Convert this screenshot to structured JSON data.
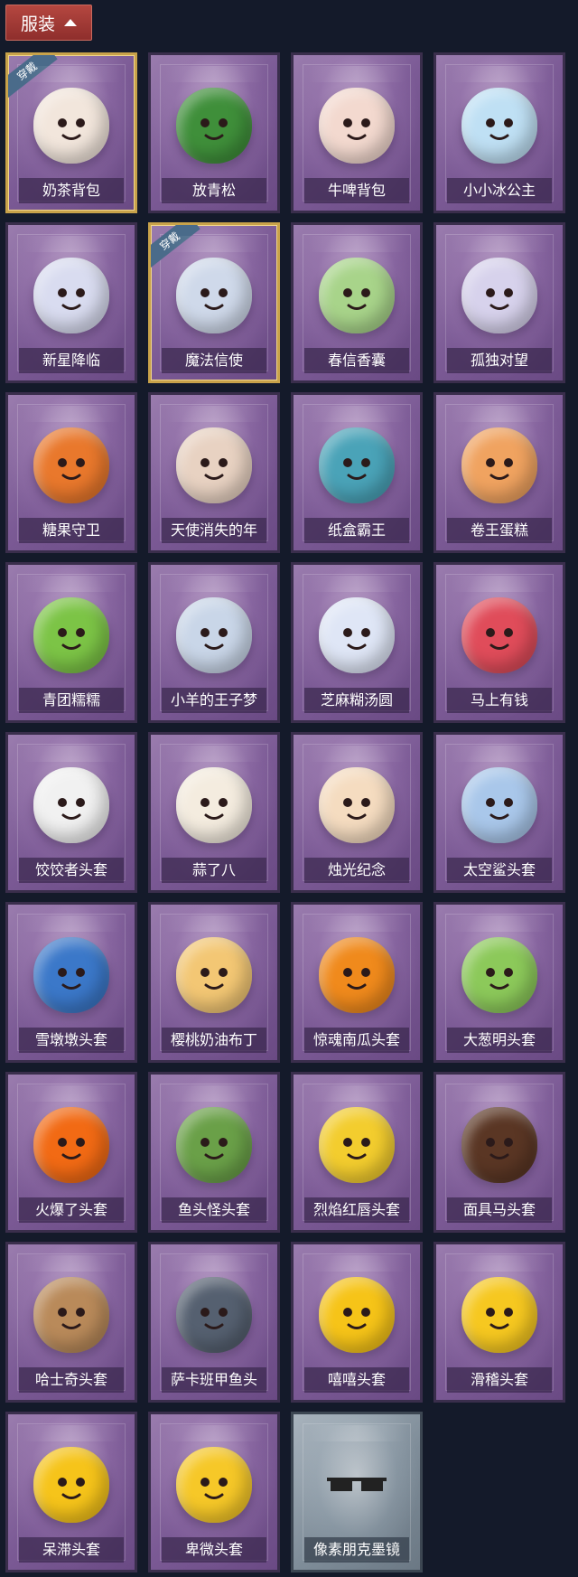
{
  "header": {
    "title": "服装",
    "toggle_icon": "chevron-up-icon"
  },
  "items": [
    {
      "name": "奶茶背包",
      "worn": true,
      "badge": "穿戴",
      "color": "#f2e6dc",
      "icon": "milk-tea-backpack-icon"
    },
    {
      "name": "放青松",
      "worn": false,
      "color": "#3f8f3a",
      "icon": "bonsai-pine-icon"
    },
    {
      "name": "牛啤背包",
      "worn": false,
      "color": "#f3d9cf",
      "icon": "cow-beer-mug-icon"
    },
    {
      "name": "小小冰公主",
      "worn": false,
      "color": "#bfe0f4",
      "icon": "ice-princess-icon"
    },
    {
      "name": "新星降临",
      "worn": false,
      "color": "#d9dcf0",
      "icon": "star-doll-icon"
    },
    {
      "name": "魔法信使",
      "worn": true,
      "badge": "穿戴",
      "color": "#cfd9ea",
      "icon": "elephant-icon"
    },
    {
      "name": "春信香囊",
      "worn": false,
      "color": "#a8d48a",
      "icon": "sachet-icon"
    },
    {
      "name": "孤独对望",
      "worn": false,
      "color": "#d7d2ec",
      "icon": "lonely-doll-icon"
    },
    {
      "name": "糖果守卫",
      "worn": false,
      "color": "#e9782c",
      "icon": "pumpkin-scarecrow-icon"
    },
    {
      "name": "天使消失的年",
      "worn": false,
      "color": "#e8d2c2",
      "icon": "angel-doll-icon"
    },
    {
      "name": "纸盒霸王",
      "worn": false,
      "color": "#4aa3b8",
      "icon": "box-dino-icon"
    },
    {
      "name": "卷王蛋糕",
      "worn": false,
      "color": "#f0a360",
      "icon": "roll-cake-icon"
    },
    {
      "name": "青团糯糯",
      "worn": false,
      "color": "#7cc446",
      "icon": "green-dumpling-icon"
    },
    {
      "name": "小羊的王子梦",
      "worn": false,
      "color": "#c9d6e8",
      "icon": "sheep-prince-icon"
    },
    {
      "name": "芝麻糊汤圆",
      "worn": false,
      "color": "#dfe6f6",
      "icon": "rice-ball-icon"
    },
    {
      "name": "马上有钱",
      "worn": false,
      "color": "#e04c5a",
      "icon": "red-horse-icon"
    },
    {
      "name": "饺饺者头套",
      "worn": false,
      "color": "#f1f1f1",
      "icon": "dumpling-head-icon"
    },
    {
      "name": "蒜了八",
      "worn": false,
      "color": "#f4ecdf",
      "icon": "garlic-icon"
    },
    {
      "name": "烛光纪念",
      "worn": false,
      "color": "#f5dcc0",
      "icon": "candle-icon"
    },
    {
      "name": "太空鲨头套",
      "worn": false,
      "color": "#a9c7ea",
      "icon": "shark-head-icon"
    },
    {
      "name": "雪墩墩头套",
      "worn": false,
      "color": "#3b78c9",
      "icon": "snow-hat-icon"
    },
    {
      "name": "樱桃奶油布丁",
      "worn": false,
      "color": "#f3c774",
      "icon": "pudding-icon"
    },
    {
      "name": "惊魂南瓜头套",
      "worn": false,
      "color": "#f08a1c",
      "icon": "pumpkin-head-icon"
    },
    {
      "name": "大葱明头套",
      "worn": false,
      "color": "#8cc95a",
      "icon": "scallion-head-icon"
    },
    {
      "name": "火爆了头套",
      "worn": false,
      "color": "#f26a14",
      "icon": "fire-head-icon"
    },
    {
      "name": "鱼头怪头套",
      "worn": false,
      "color": "#6aa048",
      "icon": "fish-head-icon"
    },
    {
      "name": "烈焰红唇头套",
      "worn": false,
      "color": "#f3cd2e",
      "icon": "pikachu-lips-icon"
    },
    {
      "name": "面具马头套",
      "worn": false,
      "color": "#5a3624",
      "icon": "horse-mask-icon"
    },
    {
      "name": "哈士奇头套",
      "worn": false,
      "color": "#b98a5a",
      "icon": "husky-head-icon"
    },
    {
      "name": "萨卡班甲鱼头",
      "worn": false,
      "color": "#556070",
      "icon": "sacabambaspis-icon"
    },
    {
      "name": "嘻嘻头套",
      "worn": false,
      "color": "#f6c418",
      "icon": "grin-emoji-icon"
    },
    {
      "name": "滑稽头套",
      "worn": false,
      "color": "#f6c820",
      "icon": "funny-emoji-icon"
    },
    {
      "name": "呆滞头套",
      "worn": false,
      "color": "#f6c41a",
      "icon": "dazed-emoji-icon"
    },
    {
      "name": "卑微头套",
      "worn": false,
      "color": "#f6c828",
      "icon": "humble-emoji-icon"
    },
    {
      "name": "像素朋克墨镜",
      "worn": false,
      "grey": true,
      "color": "#222222",
      "icon": "pixel-sunglasses-icon"
    }
  ]
}
